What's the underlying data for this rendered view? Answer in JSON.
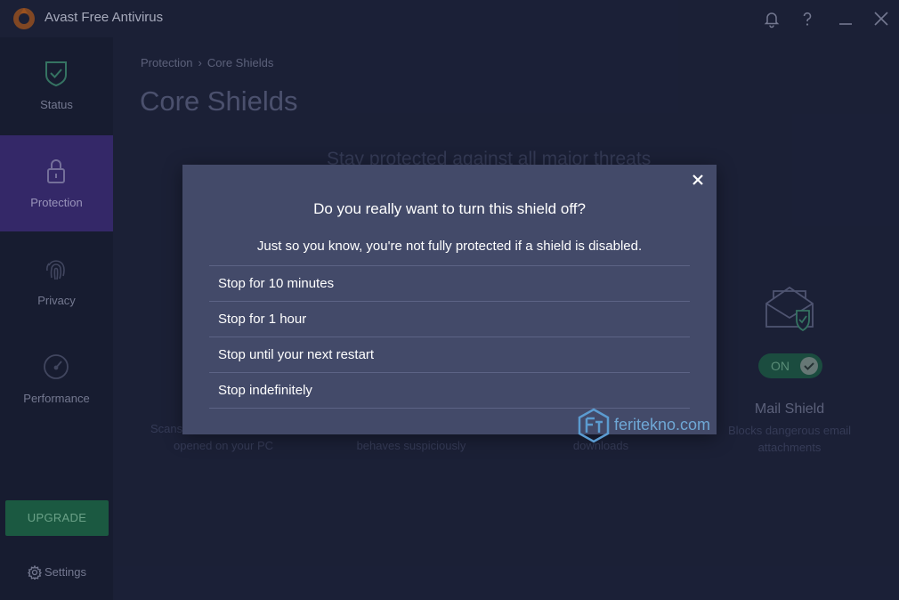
{
  "app": {
    "title": "Avast Free Antivirus",
    "accent": "#ff7800"
  },
  "titlebar": {
    "icons": [
      "bell-icon",
      "help-icon",
      "minimize-icon",
      "close-icon"
    ]
  },
  "sidebar": {
    "items": [
      {
        "label": "Status",
        "icon": "shield-check-icon",
        "active": false
      },
      {
        "label": "Protection",
        "icon": "lock-icon",
        "active": true
      },
      {
        "label": "Privacy",
        "icon": "fingerprint-icon",
        "active": false
      },
      {
        "label": "Performance",
        "icon": "speedometer-icon",
        "active": false
      }
    ],
    "upgrade_label": "UPGRADE",
    "settings_label": "Settings"
  },
  "main": {
    "breadcrumb": [
      "Protection",
      "›",
      "Core Shields"
    ],
    "title": "Core Shields",
    "subtitle": "Stay protected against all major threats",
    "shields": [
      {
        "desc_line1": "Scans",
        "desc_line2": "opened on your PC"
      },
      {
        "desc_line1": "",
        "desc_line2": "behaves suspiciously"
      },
      {
        "desc_line1": "",
        "desc_line2": "downloads"
      }
    ],
    "mail_shield": {
      "name": "Mail Shield",
      "toggle_label": "ON",
      "desc": "Blocks dangerous email attachments"
    }
  },
  "modal": {
    "title": "Do you really want to turn this shield off?",
    "message": "Just so you know, you're not fully protected if a shield is disabled.",
    "options": [
      "Stop for 10 minutes",
      "Stop for 1 hour",
      "Stop until your next restart",
      "Stop indefinitely"
    ]
  },
  "watermark": {
    "text": "feritekno.com"
  }
}
